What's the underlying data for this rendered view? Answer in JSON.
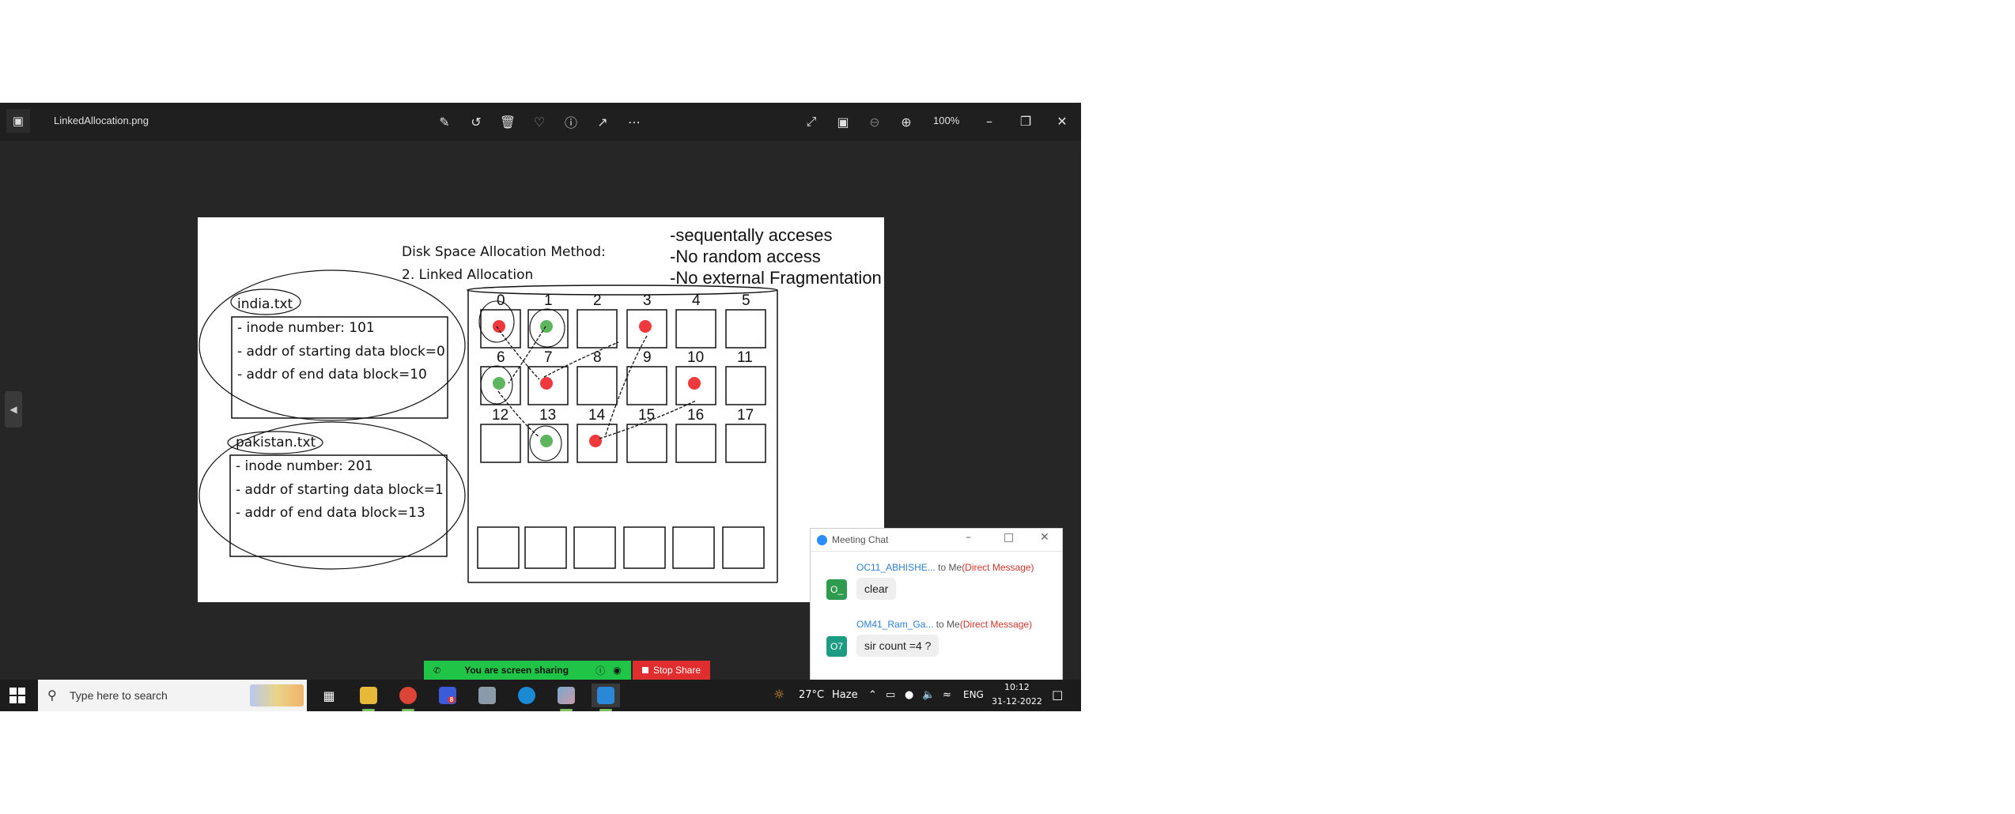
{
  "window": {
    "file_name": "LinkedAllocation.png",
    "zoom": "100%",
    "toolbar_icons": [
      "edit-icon",
      "rotate-icon",
      "delete-icon",
      "favorite-icon",
      "info-icon",
      "share-icon",
      "more-icon"
    ],
    "view_icons": [
      "fullscreen-icon",
      "fit-icon",
      "zoom-out-icon",
      "zoom-in-icon"
    ]
  },
  "drawing": {
    "heading_line1": "Disk Space Allocation Method:",
    "heading_line2": "2. Linked Allocation",
    "notes": [
      "-sequentally acceses",
      "-No random access",
      "-No external Fragmentation"
    ],
    "file1": {
      "name": "india.txt",
      "lines": [
        "- inode number: 101",
        "- addr of starting data block=0",
        "- addr of end data block=10"
      ]
    },
    "file2": {
      "name": "pakistan.txt",
      "lines": [
        "- inode number: 201",
        "- addr of starting data block=1",
        "- addr of end data block=13"
      ]
    },
    "block_numbers": [
      "0",
      "1",
      "2",
      "3",
      "4",
      "5",
      "6",
      "7",
      "8",
      "9",
      "10",
      "11",
      "12",
      "13",
      "14",
      "15",
      "16",
      "17"
    ],
    "red_dot_blocks": [
      0,
      3,
      7,
      10,
      14
    ],
    "green_dot_blocks": [
      1,
      6,
      13
    ],
    "colors": {
      "red": "#f0393c",
      "green": "#5db55d",
      "ink": "#111111"
    }
  },
  "chat": {
    "title": "Meeting Chat",
    "messages": [
      {
        "from": "OC11_ABHISHE...",
        "to": "to Me",
        "dm": "(Direct Message)",
        "avatar": "O_",
        "avatar_color": "#2e9b4e",
        "text": "clear"
      },
      {
        "from": "OM41_Ram_Ga...",
        "to": "to Me",
        "dm": "(Direct Message)",
        "avatar": "O7",
        "avatar_color": "#1e9c83",
        "text": "sir count =4 ?"
      }
    ]
  },
  "share_bar": {
    "status": "You are screen sharing",
    "stop_label": "Stop Share"
  },
  "taskbar": {
    "search_placeholder": "Type here to search",
    "weather_temp": "27°C",
    "weather_desc": "Haze",
    "language": "ENG",
    "time": "10:12",
    "date": "31-12-2022",
    "mail_badge": "8"
  }
}
